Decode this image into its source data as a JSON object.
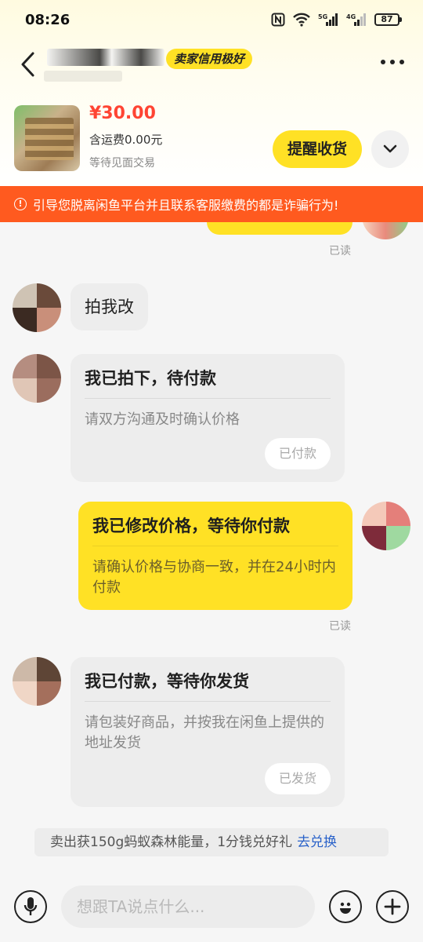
{
  "status_bar": {
    "time": "08:26",
    "battery": "87",
    "network_label_1": "5G",
    "network_label_2": "4G"
  },
  "nav": {
    "credit_badge": "卖家信用极好"
  },
  "product": {
    "price": "¥30.00",
    "shipping": "含运费0.00元",
    "trade_status": "等待见面交易",
    "remind_button": "提醒收货"
  },
  "warning": {
    "text": "引导您脱离闲鱼平台并且联系客服缴费的都是诈骗行为!"
  },
  "chat": {
    "read_label_1": "已读",
    "message_plain": "拍我改",
    "card_1": {
      "title": "我已拍下，待付款",
      "desc": "请双方沟通及时确认价格",
      "action": "已付款"
    },
    "card_2": {
      "title": "我已修改价格，等待你付款",
      "desc": "请确认价格与协商一致，并在24小时内付款"
    },
    "read_label_2": "已读",
    "card_3": {
      "title": "我已付款，等待你发货",
      "desc": "请包装好商品，并按我在闲鱼上提供的地址发货",
      "action": "已发货"
    },
    "energy_notice": "卖出获150g蚂蚁森林能量，1分钱兑好礼",
    "energy_link": "去兑换"
  },
  "input": {
    "placeholder": "想跟TA说点什么..."
  },
  "colors": {
    "brand_yellow": "#ffe125",
    "warning_orange": "#ff5a1f",
    "price_red": "#ff4433",
    "link_blue": "#2a62c9"
  }
}
